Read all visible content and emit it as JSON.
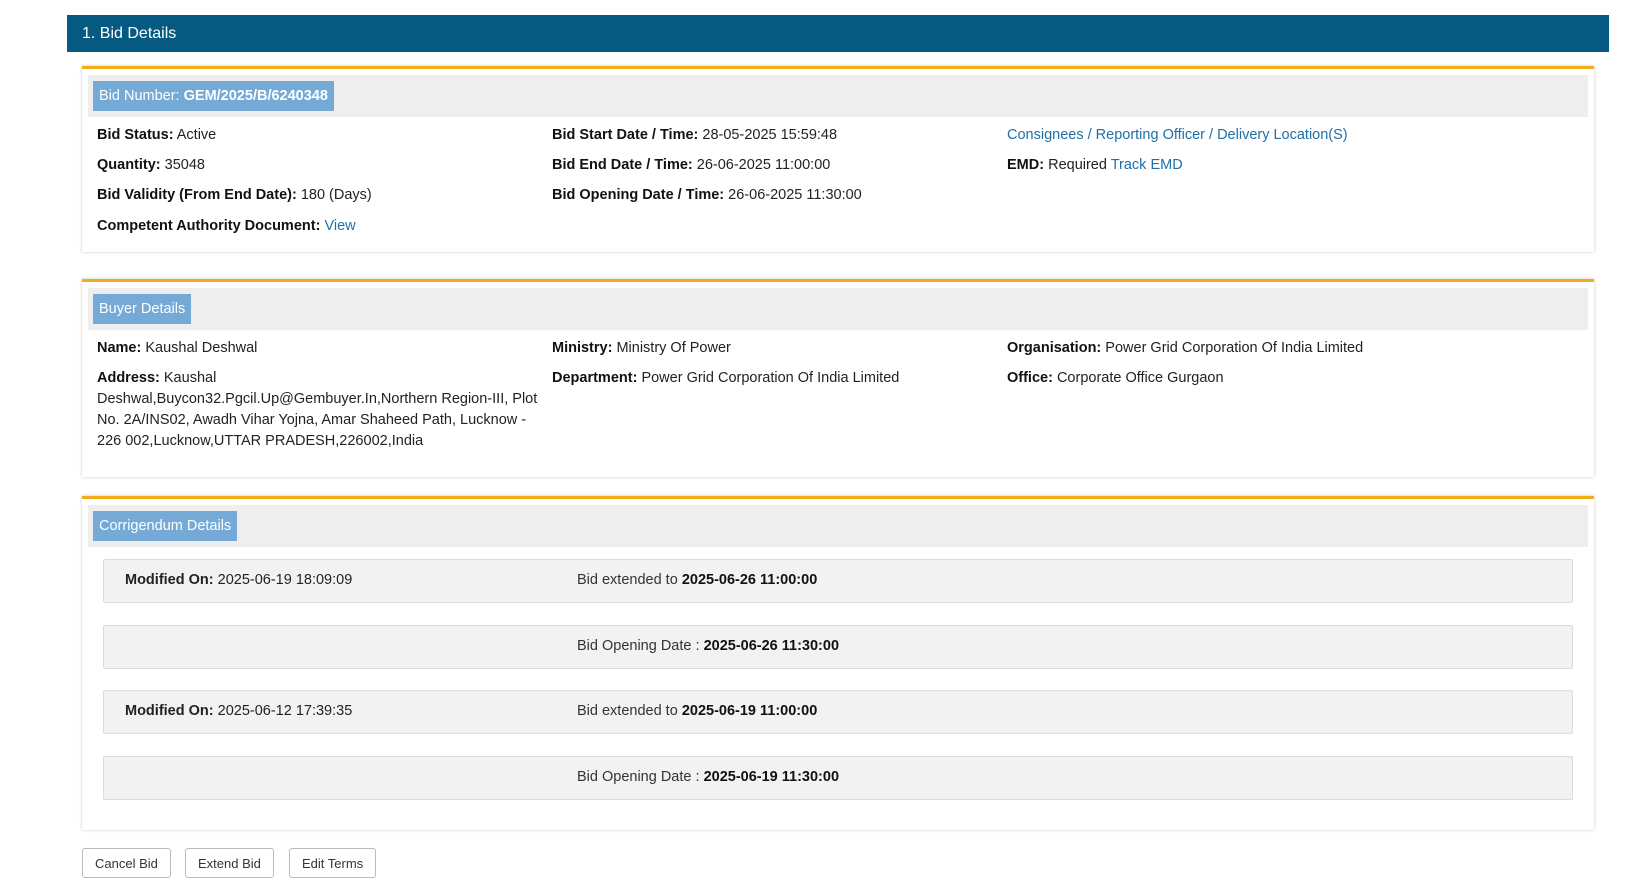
{
  "section_title": "1. Bid Details",
  "bid": {
    "number_label": "Bid Number:",
    "number_value": "GEM/2025/B/6240348",
    "status_label": "Bid Status:",
    "status_value": "Active",
    "quantity_label": "Quantity:",
    "quantity_value": "35048",
    "validity_label": "Bid Validity (From End Date):",
    "validity_value": "180 (Days)",
    "authority_label": "Competent Authority Document:",
    "authority_link": "View",
    "start_label": "Bid Start Date / Time:",
    "start_value": "28-05-2025 15:59:48",
    "end_label": "Bid End Date / Time:",
    "end_value": "26-06-2025 11:00:00",
    "opening_label": "Bid Opening Date / Time:",
    "opening_value": "26-06-2025 11:30:00",
    "consignees_link": "Consignees / Reporting Officer / Delivery Location(S)",
    "emd_label": "EMD:",
    "emd_value": "Required",
    "emd_link": "Track EMD"
  },
  "buyer": {
    "title": "Buyer Details",
    "name_label": "Name:",
    "name_value": "Kaushal Deshwal",
    "address_label": "Address:",
    "address_value": "Kaushal Deshwal,Buycon32.Pgcil.Up@Gembuyer.In,Northern Region-III, Plot No. 2A/INS02, Awadh Vihar Yojna, Amar Shaheed Path, Lucknow - 226 002,Lucknow,UTTAR PRADESH,226002,India",
    "ministry_label": "Ministry:",
    "ministry_value": "Ministry Of Power",
    "department_label": "Department:",
    "department_value": "Power Grid Corporation Of India Limited",
    "organisation_label": "Organisation:",
    "organisation_value": "Power Grid Corporation Of India Limited",
    "office_label": "Office:",
    "office_value": "Corporate Office Gurgaon"
  },
  "corrigendum": {
    "title": "Corrigendum Details",
    "modified_label": "Modified On:",
    "rows": [
      {
        "modified": "2025-06-19 18:09:09",
        "text": "Bid extended to ",
        "date": "2025-06-26 11:00:00"
      },
      {
        "modified": "",
        "text": "Bid Opening Date : ",
        "date": "2025-06-26 11:30:00"
      },
      {
        "modified": "2025-06-12 17:39:35",
        "text": "Bid extended to ",
        "date": "2025-06-19 11:00:00"
      },
      {
        "modified": "",
        "text": "Bid Opening Date : ",
        "date": "2025-06-19 11:30:00"
      }
    ]
  },
  "buttons": {
    "cancel": "Cancel Bid",
    "extend": "Extend Bid",
    "edit": "Edit Terms"
  },
  "colors": {
    "header_bg": "#065a82",
    "accent_border": "#f0ad1a",
    "tag_bg": "#75a9d6",
    "link": "#1f6fa8"
  }
}
